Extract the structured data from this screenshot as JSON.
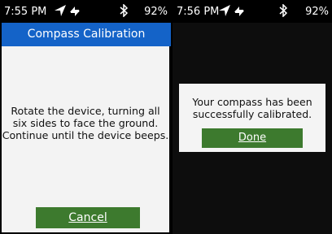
{
  "left_screen": {
    "status": {
      "time": "7:55 PM",
      "battery": "92%"
    },
    "title": "Compass Calibration",
    "message_lines": [
      "Rotate the device, turning all",
      "six sides to face the ground.",
      "Continue until the device beeps."
    ],
    "cancel_label": "Cancel"
  },
  "right_screen": {
    "status": {
      "time": "7:56 PM",
      "battery": "92%"
    },
    "dialog_lines": [
      "Your compass has been",
      "successfully calibrated."
    ],
    "done_label": "Done"
  },
  "icons": {
    "navigation": "navigation-arrow-icon",
    "sync": "sync-arrows-icon",
    "bluetooth": "bluetooth-icon"
  },
  "colors": {
    "title_bar": "#1463c8",
    "button": "#3d7a2e",
    "panel": "#f3f3f3"
  }
}
